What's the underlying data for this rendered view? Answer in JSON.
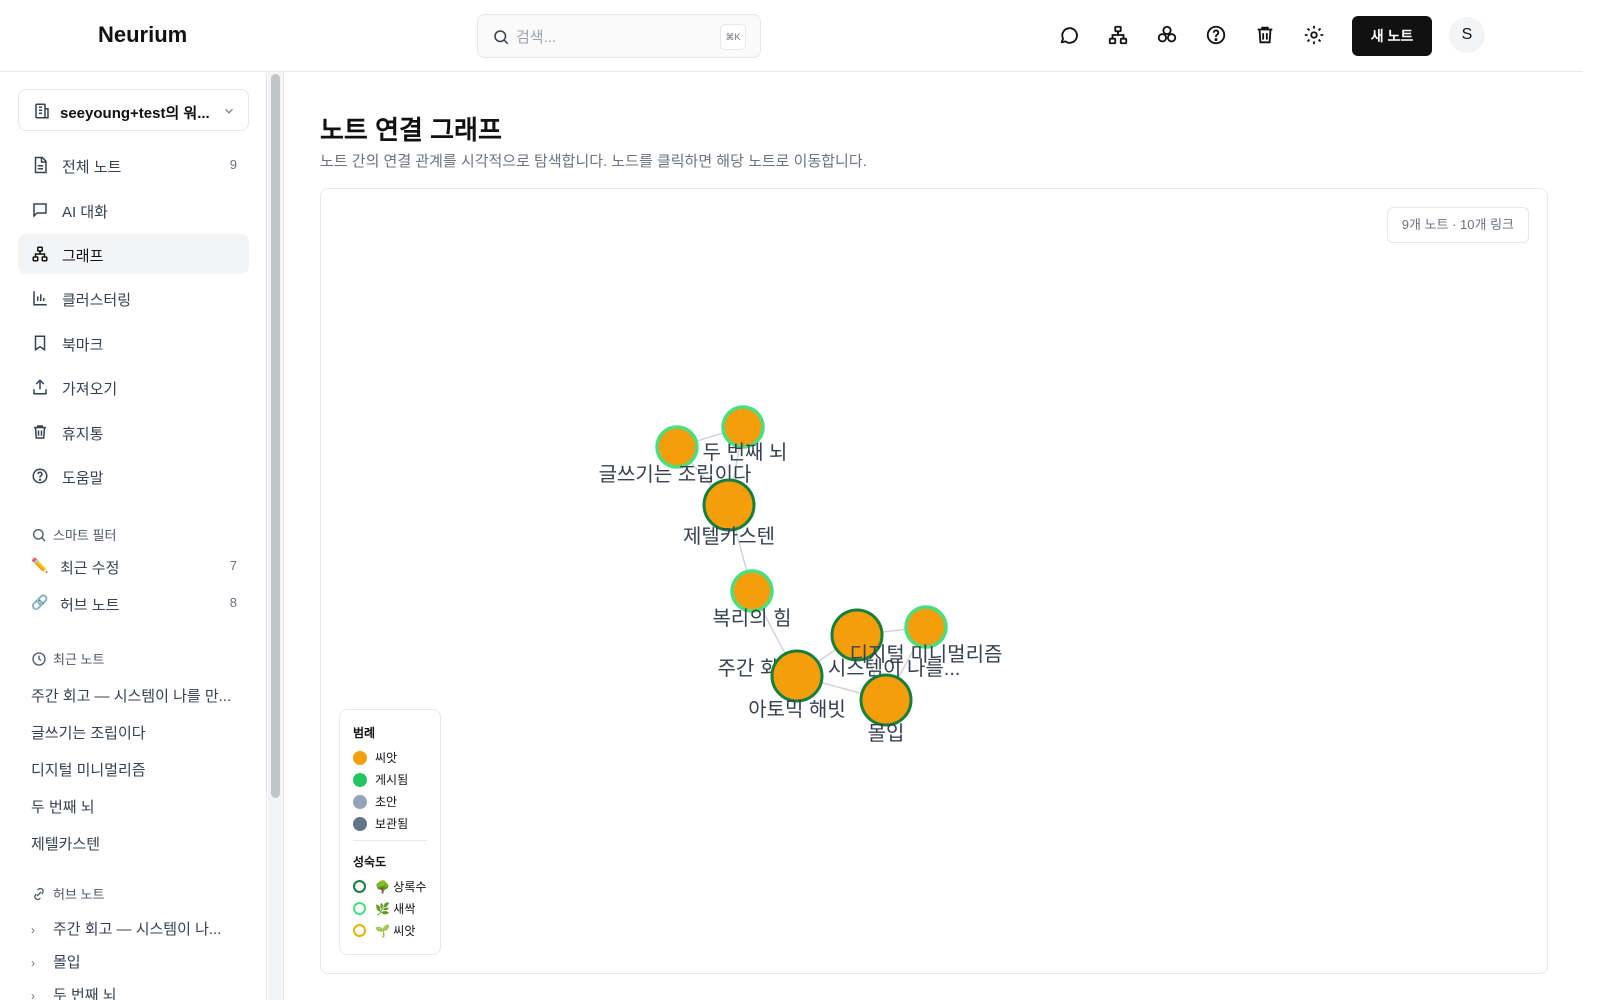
{
  "header": {
    "logo": "Neurium",
    "search_placeholder": "검색...",
    "search_shortcut": "⌘K",
    "new_note_label": "새 노트",
    "avatar_initial": "S"
  },
  "sidebar": {
    "workspace_name": "seeyoung+test의 워...",
    "nav": [
      {
        "label": "전체 노트",
        "count": "9"
      },
      {
        "label": "AI 대화",
        "count": ""
      },
      {
        "label": "그래프",
        "count": ""
      },
      {
        "label": "클러스터링",
        "count": ""
      },
      {
        "label": "북마크",
        "count": ""
      },
      {
        "label": "가져오기",
        "count": ""
      },
      {
        "label": "휴지통",
        "count": ""
      },
      {
        "label": "도움말",
        "count": ""
      }
    ],
    "smart_filter_title": "스마트 필터",
    "smart_filters": [
      {
        "emoji": "✏️",
        "label": "최근 수정",
        "count": "7"
      },
      {
        "emoji": "🔗",
        "label": "허브 노트",
        "count": "8"
      }
    ],
    "recent_title": "최근 노트",
    "recent_notes": [
      "주간 회고 — 시스템이 나를 만...",
      "글쓰기는 조립이다",
      "디지털 미니멀리즘",
      "두 번째 뇌",
      "제텔카스텐"
    ],
    "hub_title": "허브 노트",
    "hub_notes": [
      "주간 회고 — 시스템이 나...",
      "몰입",
      "두 번째 뇌"
    ]
  },
  "main": {
    "title": "노트 연결 그래프",
    "subtitle": "노트 간의 연결 관계를 시각적으로 탐색합니다. 노드를 클릭하면 해당 노트로 이동합니다.",
    "stats": "9개 노트 · 10개 링크"
  },
  "legend": {
    "title": "범례",
    "status_items": [
      {
        "label": "씨앗",
        "color": "#f59e0b"
      },
      {
        "label": "게시됨",
        "color": "#22c55e"
      },
      {
        "label": "초안",
        "color": "#94a3b8"
      },
      {
        "label": "보관됨",
        "color": "#64748b"
      }
    ],
    "maturity_title": "성숙도",
    "maturity_items": [
      {
        "emoji": "🌳",
        "label": "상록수",
        "color": "#15803d"
      },
      {
        "emoji": "🌿",
        "label": "새싹",
        "color": "#4ade80"
      },
      {
        "emoji": "🌱",
        "label": "씨앗",
        "color": "#eab308"
      }
    ]
  },
  "graph": {
    "nodes": [
      {
        "id": "second-brain",
        "label": "두 번째 뇌",
        "maturity": "새싹",
        "status": "씨앗"
      },
      {
        "id": "writing",
        "label": "글쓰기는 조립이다",
        "maturity": "새싹",
        "status": "씨앗"
      },
      {
        "id": "zettel",
        "label": "제텔카스텐",
        "maturity": "상록수",
        "status": "씨앗"
      },
      {
        "id": "compound",
        "label": "복리의 힘",
        "maturity": "새싹",
        "status": "씨앗"
      },
      {
        "id": "weekly",
        "label": "주간 회고 — 시스템이 나를...",
        "maturity": "상록수",
        "status": "씨앗"
      },
      {
        "id": "digital",
        "label": "디지털 미니멀리즘",
        "maturity": "새싹",
        "status": "씨앗"
      },
      {
        "id": "atomic",
        "label": "아토믹 해빗",
        "maturity": "상록수",
        "status": "씨앗"
      },
      {
        "id": "flow",
        "label": "몰입",
        "maturity": "상록수",
        "status": "씨앗"
      }
    ],
    "colors": {
      "fill": "#f59e0b",
      "evergreen": "#15803d",
      "sprout": "#4ade80",
      "edge": "#d1d5db",
      "label": "#374151"
    }
  }
}
